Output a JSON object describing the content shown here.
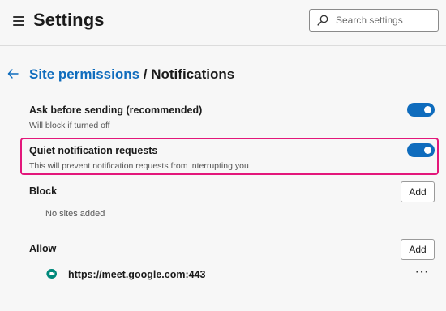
{
  "header": {
    "title": "Settings",
    "menu_icon": "hamburger-menu-icon",
    "search": {
      "placeholder": "Search settings",
      "value": "",
      "icon": "search-icon"
    }
  },
  "breadcrumb": {
    "back_icon": "back-arrow-icon",
    "parent": "Site permissions",
    "separator": " / ",
    "current": "Notifications"
  },
  "settings": {
    "ask_before_sending": {
      "title": "Ask before sending (recommended)",
      "description": "Will block if turned off",
      "enabled": true
    },
    "quiet_requests": {
      "title": "Quiet notification requests",
      "description": "This will prevent notification requests from interrupting you",
      "enabled": true,
      "highlighted": true
    }
  },
  "block": {
    "label": "Block",
    "add_label": "Add",
    "empty_text": "No sites added"
  },
  "allow": {
    "label": "Allow",
    "add_label": "Add",
    "sites": [
      {
        "url": "https://meet.google.com:443",
        "icon": "google-meet-icon",
        "more_label": "···"
      }
    ]
  },
  "colors": {
    "accent": "#0f6cbd",
    "highlight": "#e3177b",
    "background": "#f7f7f7",
    "site_icon": "#00897b"
  }
}
